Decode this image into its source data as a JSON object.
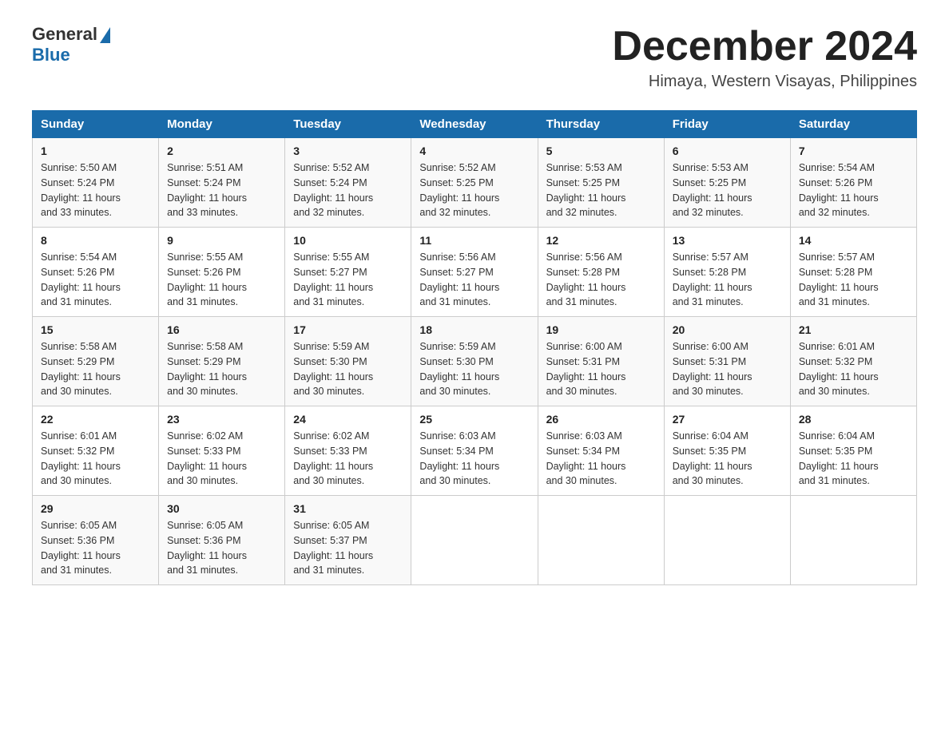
{
  "logo": {
    "text_general": "General",
    "text_blue": "Blue"
  },
  "header": {
    "month_year": "December 2024",
    "location": "Himaya, Western Visayas, Philippines"
  },
  "weekdays": [
    "Sunday",
    "Monday",
    "Tuesday",
    "Wednesday",
    "Thursday",
    "Friday",
    "Saturday"
  ],
  "weeks": [
    [
      {
        "day": "1",
        "sunrise": "5:50 AM",
        "sunset": "5:24 PM",
        "daylight": "11 hours and 33 minutes."
      },
      {
        "day": "2",
        "sunrise": "5:51 AM",
        "sunset": "5:24 PM",
        "daylight": "11 hours and 33 minutes."
      },
      {
        "day": "3",
        "sunrise": "5:52 AM",
        "sunset": "5:24 PM",
        "daylight": "11 hours and 32 minutes."
      },
      {
        "day": "4",
        "sunrise": "5:52 AM",
        "sunset": "5:25 PM",
        "daylight": "11 hours and 32 minutes."
      },
      {
        "day": "5",
        "sunrise": "5:53 AM",
        "sunset": "5:25 PM",
        "daylight": "11 hours and 32 minutes."
      },
      {
        "day": "6",
        "sunrise": "5:53 AM",
        "sunset": "5:25 PM",
        "daylight": "11 hours and 32 minutes."
      },
      {
        "day": "7",
        "sunrise": "5:54 AM",
        "sunset": "5:26 PM",
        "daylight": "11 hours and 32 minutes."
      }
    ],
    [
      {
        "day": "8",
        "sunrise": "5:54 AM",
        "sunset": "5:26 PM",
        "daylight": "11 hours and 31 minutes."
      },
      {
        "day": "9",
        "sunrise": "5:55 AM",
        "sunset": "5:26 PM",
        "daylight": "11 hours and 31 minutes."
      },
      {
        "day": "10",
        "sunrise": "5:55 AM",
        "sunset": "5:27 PM",
        "daylight": "11 hours and 31 minutes."
      },
      {
        "day": "11",
        "sunrise": "5:56 AM",
        "sunset": "5:27 PM",
        "daylight": "11 hours and 31 minutes."
      },
      {
        "day": "12",
        "sunrise": "5:56 AM",
        "sunset": "5:28 PM",
        "daylight": "11 hours and 31 minutes."
      },
      {
        "day": "13",
        "sunrise": "5:57 AM",
        "sunset": "5:28 PM",
        "daylight": "11 hours and 31 minutes."
      },
      {
        "day": "14",
        "sunrise": "5:57 AM",
        "sunset": "5:28 PM",
        "daylight": "11 hours and 31 minutes."
      }
    ],
    [
      {
        "day": "15",
        "sunrise": "5:58 AM",
        "sunset": "5:29 PM",
        "daylight": "11 hours and 30 minutes."
      },
      {
        "day": "16",
        "sunrise": "5:58 AM",
        "sunset": "5:29 PM",
        "daylight": "11 hours and 30 minutes."
      },
      {
        "day": "17",
        "sunrise": "5:59 AM",
        "sunset": "5:30 PM",
        "daylight": "11 hours and 30 minutes."
      },
      {
        "day": "18",
        "sunrise": "5:59 AM",
        "sunset": "5:30 PM",
        "daylight": "11 hours and 30 minutes."
      },
      {
        "day": "19",
        "sunrise": "6:00 AM",
        "sunset": "5:31 PM",
        "daylight": "11 hours and 30 minutes."
      },
      {
        "day": "20",
        "sunrise": "6:00 AM",
        "sunset": "5:31 PM",
        "daylight": "11 hours and 30 minutes."
      },
      {
        "day": "21",
        "sunrise": "6:01 AM",
        "sunset": "5:32 PM",
        "daylight": "11 hours and 30 minutes."
      }
    ],
    [
      {
        "day": "22",
        "sunrise": "6:01 AM",
        "sunset": "5:32 PM",
        "daylight": "11 hours and 30 minutes."
      },
      {
        "day": "23",
        "sunrise": "6:02 AM",
        "sunset": "5:33 PM",
        "daylight": "11 hours and 30 minutes."
      },
      {
        "day": "24",
        "sunrise": "6:02 AM",
        "sunset": "5:33 PM",
        "daylight": "11 hours and 30 minutes."
      },
      {
        "day": "25",
        "sunrise": "6:03 AM",
        "sunset": "5:34 PM",
        "daylight": "11 hours and 30 minutes."
      },
      {
        "day": "26",
        "sunrise": "6:03 AM",
        "sunset": "5:34 PM",
        "daylight": "11 hours and 30 minutes."
      },
      {
        "day": "27",
        "sunrise": "6:04 AM",
        "sunset": "5:35 PM",
        "daylight": "11 hours and 30 minutes."
      },
      {
        "day": "28",
        "sunrise": "6:04 AM",
        "sunset": "5:35 PM",
        "daylight": "11 hours and 31 minutes."
      }
    ],
    [
      {
        "day": "29",
        "sunrise": "6:05 AM",
        "sunset": "5:36 PM",
        "daylight": "11 hours and 31 minutes."
      },
      {
        "day": "30",
        "sunrise": "6:05 AM",
        "sunset": "5:36 PM",
        "daylight": "11 hours and 31 minutes."
      },
      {
        "day": "31",
        "sunrise": "6:05 AM",
        "sunset": "5:37 PM",
        "daylight": "11 hours and 31 minutes."
      },
      null,
      null,
      null,
      null
    ]
  ],
  "labels": {
    "sunrise": "Sunrise:",
    "sunset": "Sunset:",
    "daylight": "Daylight:"
  }
}
